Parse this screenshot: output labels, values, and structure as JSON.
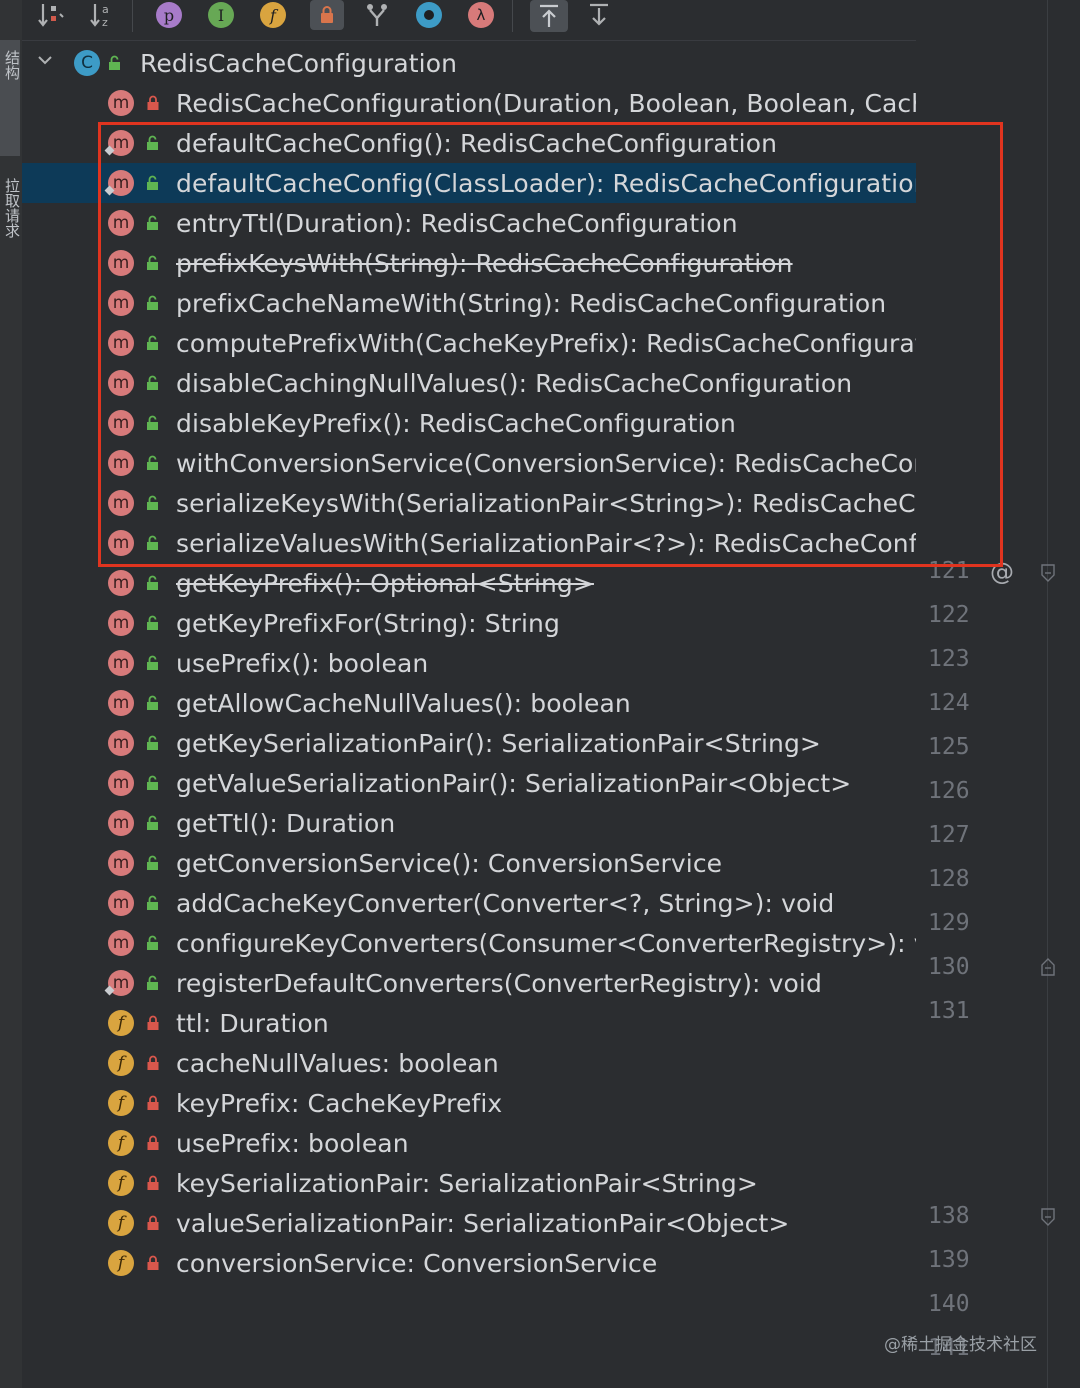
{
  "sidebar": {
    "tab1": "结构",
    "tab2": "拉取请求"
  },
  "toolbar": {
    "buttons": [
      {
        "name": "sort-visibility-button",
        "glyph": "↓⁝"
      },
      {
        "name": "sort-alpha-button",
        "glyph": "↓ᵃz"
      },
      {
        "name": "show-properties-button",
        "glyph": "p"
      },
      {
        "name": "show-inherited-button",
        "glyph": "I"
      },
      {
        "name": "show-fields-button",
        "glyph": "f"
      },
      {
        "name": "show-non-public-button",
        "glyph": "🔒"
      },
      {
        "name": "show-anonymous-button",
        "glyph": "⑂"
      },
      {
        "name": "show-lambdas-o-button",
        "glyph": "◉"
      },
      {
        "name": "show-lambdas-button",
        "glyph": "λ"
      },
      {
        "name": "expand-all-button",
        "glyph": "⤒"
      },
      {
        "name": "collapse-all-button",
        "glyph": "⤓"
      }
    ]
  },
  "tree": {
    "root": {
      "label": "RedisCacheConfiguration",
      "kind": "c"
    },
    "items": [
      {
        "label": "RedisCacheConfiguration(Duration, Boolean, Boolean, CacheKeyPrefix, SerializationPair<String>, SerializationPair<?>, ConversionService)",
        "kind": "m",
        "access": "private"
      },
      {
        "label": "defaultCacheConfig(): RedisCacheConfiguration",
        "kind": "m",
        "access": "public",
        "static": true
      },
      {
        "label": "defaultCacheConfig(ClassLoader): RedisCacheConfiguration",
        "kind": "m",
        "access": "public",
        "static": true,
        "selected": true
      },
      {
        "label": "entryTtl(Duration): RedisCacheConfiguration",
        "kind": "m",
        "access": "public"
      },
      {
        "label": "prefixKeysWith(String): RedisCacheConfiguration",
        "kind": "m",
        "access": "public",
        "deprecated": true
      },
      {
        "label": "prefixCacheNameWith(String): RedisCacheConfiguration",
        "kind": "m",
        "access": "public"
      },
      {
        "label": "computePrefixWith(CacheKeyPrefix): RedisCacheConfiguration",
        "kind": "m",
        "access": "public"
      },
      {
        "label": "disableCachingNullValues(): RedisCacheConfiguration",
        "kind": "m",
        "access": "public"
      },
      {
        "label": "disableKeyPrefix(): RedisCacheConfiguration",
        "kind": "m",
        "access": "public"
      },
      {
        "label": "withConversionService(ConversionService): RedisCacheConfiguration",
        "kind": "m",
        "access": "public"
      },
      {
        "label": "serializeKeysWith(SerializationPair<String>): RedisCacheConfiguration",
        "kind": "m",
        "access": "public"
      },
      {
        "label": "serializeValuesWith(SerializationPair<?>): RedisCacheConfiguration",
        "kind": "m",
        "access": "public"
      },
      {
        "label": "getKeyPrefix(): Optional<String>",
        "kind": "m",
        "access": "public",
        "deprecated": true
      },
      {
        "label": "getKeyPrefixFor(String): String",
        "kind": "m",
        "access": "public"
      },
      {
        "label": "usePrefix(): boolean",
        "kind": "m",
        "access": "public"
      },
      {
        "label": "getAllowCacheNullValues(): boolean",
        "kind": "m",
        "access": "public"
      },
      {
        "label": "getKeySerializationPair(): SerializationPair<String>",
        "kind": "m",
        "access": "public"
      },
      {
        "label": "getValueSerializationPair(): SerializationPair<Object>",
        "kind": "m",
        "access": "public"
      },
      {
        "label": "getTtl(): Duration",
        "kind": "m",
        "access": "public"
      },
      {
        "label": "getConversionService(): ConversionService",
        "kind": "m",
        "access": "public"
      },
      {
        "label": "addCacheKeyConverter(Converter<?, String>): void",
        "kind": "m",
        "access": "public"
      },
      {
        "label": "configureKeyConverters(Consumer<ConverterRegistry>): void",
        "kind": "m",
        "access": "public"
      },
      {
        "label": "registerDefaultConverters(ConverterRegistry): void",
        "kind": "m",
        "access": "public",
        "static": true
      },
      {
        "label": "ttl: Duration",
        "kind": "f",
        "access": "private"
      },
      {
        "label": "cacheNullValues: boolean",
        "kind": "f",
        "access": "private"
      },
      {
        "label": "keyPrefix: CacheKeyPrefix",
        "kind": "f",
        "access": "private"
      },
      {
        "label": "usePrefix: boolean",
        "kind": "f",
        "access": "private"
      },
      {
        "label": "keySerializationPair: SerializationPair<String>",
        "kind": "f",
        "access": "private"
      },
      {
        "label": "valueSerializationPair: SerializationPair<Object>",
        "kind": "f",
        "access": "private"
      },
      {
        "label": "conversionService: ConversionService",
        "kind": "f",
        "access": "private"
      }
    ]
  },
  "gutter": {
    "lines": [
      "121",
      "122",
      "123",
      "124",
      "125",
      "126",
      "127",
      "128",
      "129",
      "130",
      "131",
      "138",
      "139",
      "140",
      "141"
    ]
  },
  "colors": {
    "highlight_box": "#e0341f",
    "selection": "#0d3a58",
    "method_icon": "#d77a7a",
    "field_icon": "#d9a43f",
    "class_icon": "#3d9bc6"
  },
  "watermark": "@稀土掘金技术社区"
}
